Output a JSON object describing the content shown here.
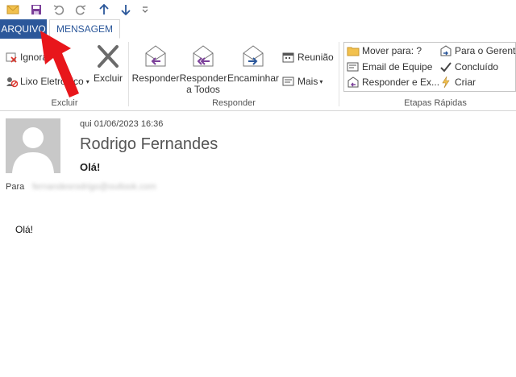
{
  "tabs": {
    "arquivo": "ARQUIVO",
    "mensagem": "MENSAGEM"
  },
  "ribbon": {
    "excluir_group": {
      "ignorar": "Ignorar",
      "lixo": "Lixo Eletrônico",
      "excluir": "Excluir",
      "label": "Excluir"
    },
    "responder_group": {
      "responder": "Responder",
      "responder_todos_1": "Responder",
      "responder_todos_2": "a Todos",
      "encaminhar": "Encaminhar",
      "reuniao": "Reunião",
      "mais": "Mais",
      "label": "Responder"
    },
    "etapas_group": {
      "mover": "Mover para: ?",
      "email_equipe": "Email de Equipe",
      "responder_ex": "Responder e Ex...",
      "para_gerente": "Para o Gerente",
      "concluido": "Concluído",
      "criar": "Criar",
      "label": "Etapas Rápidas"
    }
  },
  "message": {
    "date": "qui 01/06/2023 16:36",
    "sender": "Rodrigo Fernandes",
    "subject": "Olá!",
    "to_label": "Para",
    "to_email": "fernandesrodrigo@outlook.com",
    "body": "Olá!"
  },
  "colors": {
    "accent": "#2b579a",
    "annotation_arrow": "#e8161b"
  }
}
